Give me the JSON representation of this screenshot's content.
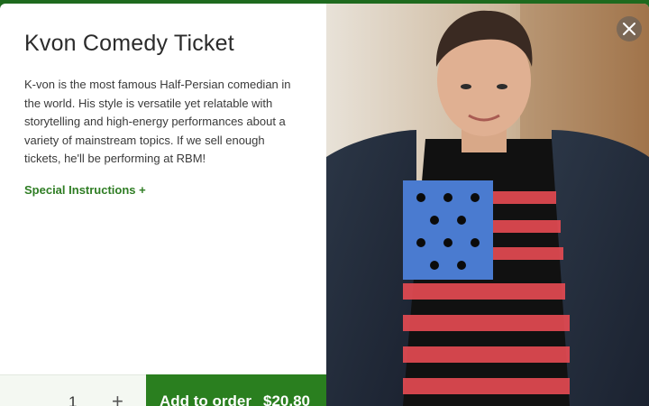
{
  "modal": {
    "title": "Kvon Comedy Ticket",
    "description": "K-von is the most famous Half-Persian comedian in the world. His style is versatile yet relatable with storytelling and high-energy performances about a variety of mainstream topics. If we sell enough tickets, he'll be performing at RBM!",
    "special_instructions": "Special Instructions +",
    "quantity": "1",
    "plus_symbol": "+",
    "add_label": "Add to order",
    "price": "$20.80",
    "close_icon": "close-icon"
  },
  "colors": {
    "accent": "#2a7f1f",
    "link": "#2f7d24",
    "header_strip": "#1e6a1e"
  }
}
